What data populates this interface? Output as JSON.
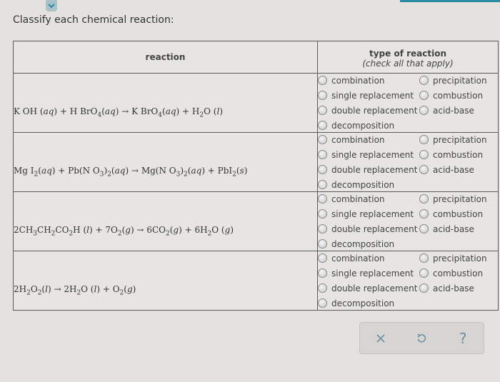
{
  "prompt": "Classify each chemical reaction:",
  "table": {
    "headers": {
      "reaction": "reaction",
      "type_title": "type of reaction",
      "type_subtitle": "(check all that apply)"
    },
    "options_left": [
      "combination",
      "single replacement",
      "double replacement",
      "decomposition"
    ],
    "options_right": [
      "precipitation",
      "combustion",
      "acid-base"
    ],
    "rows": [
      {
        "equation_html": "K OH (<i>aq</i>) + H BrO<sub>4</sub>(<i>aq</i>) &#8594; K BrO<sub>4</sub>(<i>aq</i>) + H<sub>2</sub>O (<i>l</i>)",
        "equation_text": "KOH(aq) + HBrO4(aq) → KBrO4(aq) + H2O(l)"
      },
      {
        "equation_html": "Mg I<sub>2</sub>(<i>aq</i>) + Pb(N O<sub>3</sub>)<sub>2</sub>(<i>aq</i>) &#8594; Mg(N O<sub>3</sub>)<sub>2</sub>(<i>aq</i>) + PbI<sub>2</sub>(<i>s</i>)",
        "equation_text": "MgI2(aq) + Pb(NO3)2(aq) → Mg(NO3)2(aq) + PbI2(s)"
      },
      {
        "equation_html": "2CH<sub>3</sub>CH<sub>2</sub>CO<sub>2</sub>H (<i>l</i>) + 7O<sub>2</sub>(<i>g</i>) &#8594; 6CO<sub>2</sub>(<i>g</i>) + 6H<sub>2</sub>O (<i>g</i>)",
        "equation_text": "2CH3CH2CO2H(l) + 7O2(g) → 6CO2(g) + 6H2O(g)"
      },
      {
        "equation_html": "2H<sub>2</sub>O<sub>2</sub>(<i>l</i>) &#8594; 2H<sub>2</sub>O (<i>l</i>) + O<sub>2</sub>(<i>g</i>)",
        "equation_text": "2H2O2(l) → 2H2O(l) + O2(g)"
      }
    ]
  },
  "toolbar": {
    "clear_icon": "x-icon",
    "undo_icon": "undo-icon",
    "help_label": "?"
  },
  "colors": {
    "accent": "#2b8ba3",
    "icon": "#6c8ea0"
  }
}
